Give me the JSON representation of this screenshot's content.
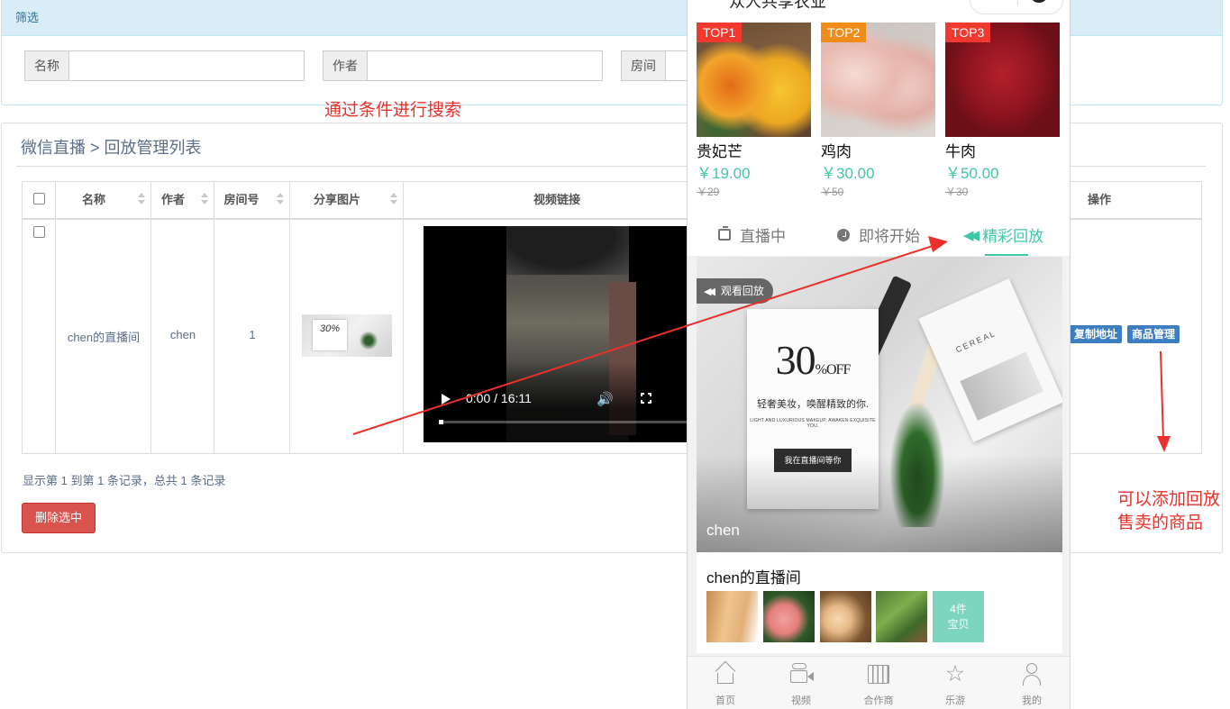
{
  "filter": {
    "header": "筛选",
    "fields": [
      {
        "label": "名称",
        "value": ""
      },
      {
        "label": "作者",
        "value": ""
      },
      {
        "label": "房间",
        "value": ""
      }
    ]
  },
  "annotations": {
    "search_hint": "通过条件进行搜索",
    "goods_hint": "可以添加回放售卖的商品",
    "arrow_color": "#e8312b"
  },
  "list": {
    "title": "微信直播 > 回放管理列表",
    "columns": [
      "名称",
      "作者",
      "房间号",
      "分享图片",
      "视频链接",
      "操作"
    ],
    "rows": [
      {
        "name": "chen的直播间",
        "author": "chen",
        "room": "1",
        "share_image": {
          "text": "30%"
        },
        "video": {
          "time": "0:00 / 16:11"
        },
        "actions": [
          "复制地址",
          "商品管理"
        ]
      }
    ],
    "pager_info": "显示第 1 到第 1 条记录，总共 1 条记录",
    "delete_label": "删除选中"
  },
  "phone": {
    "title": "众人共享农业",
    "top_products": [
      {
        "badge": "TOP1",
        "badge_color": "#f2392f",
        "name": "贵妃芒",
        "price": "￥19.00",
        "old_price": "￥29"
      },
      {
        "badge": "TOP2",
        "badge_color": "#f08c1a",
        "name": "鸡肉",
        "price": "￥30.00",
        "old_price": "￥50"
      },
      {
        "badge": "TOP3",
        "badge_color": "#f2392f",
        "name": "牛肉",
        "price": "￥50.00",
        "old_price": "￥30"
      }
    ],
    "tabs": [
      {
        "label": "直播中",
        "icon": "tv-icon"
      },
      {
        "label": "即将开始",
        "icon": "clock-icon"
      },
      {
        "label": "精彩回放",
        "icon": "rewind-icon",
        "active": true
      }
    ],
    "banner": {
      "replay_label": "观看回放",
      "promo_big": "30",
      "promo_pct": "%",
      "promo_off": "OFF",
      "promo_line1": "轻奢美妆，唤醒精致的你.",
      "promo_line2": "LIGHT AND LUXURIOUS MAKEUP, AWAKEN EXQUISITE YOU.",
      "promo_button": "我在直播间等你",
      "cereal_text": "CEREAL",
      "author": "chen"
    },
    "room": {
      "name": "chen的直播间",
      "count_line1": "4件",
      "count_line2": "宝贝"
    },
    "tabbar": [
      "首页",
      "视频",
      "合作商",
      "乐游",
      "我的"
    ],
    "accent_color": "#3ec8a8"
  }
}
